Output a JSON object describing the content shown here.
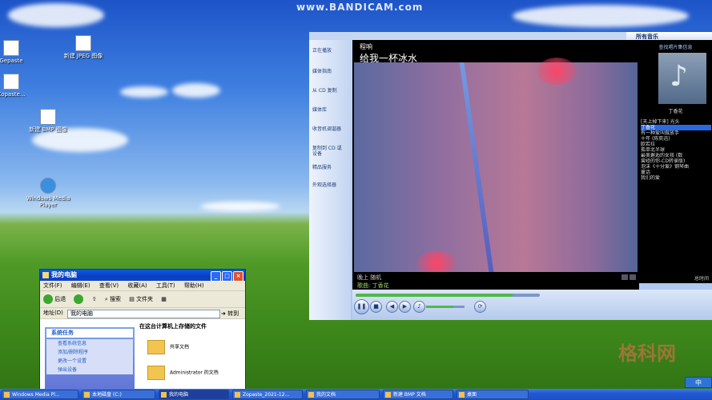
{
  "recorder": {
    "watermark": "www.BANDICAM.com"
  },
  "corner_logo": "格科网",
  "desktop_icons": [
    {
      "label": "Gepaste"
    },
    {
      "label": "新建 JPEG 图像"
    },
    {
      "label": "Zopaste..."
    },
    {
      "label": "新建 BMP 图像"
    },
    {
      "label": "Windows Media Player"
    }
  ],
  "explorer": {
    "title": "我的电脑",
    "menu": [
      "文件(F)",
      "编辑(E)",
      "查看(V)",
      "收藏(A)",
      "工具(T)",
      "帮助(H)"
    ],
    "toolbar": {
      "back": "后退",
      "search": "搜索",
      "folders": "文件夹"
    },
    "address_label": "地址(D)",
    "address_value": "我的电脑",
    "go_label": "转到",
    "task_header": "系统任务",
    "tasks": [
      "查看系统信息",
      "添加/删除程序",
      "更改一个设置",
      "弹出设备"
    ],
    "section_header": "在这台计算机上存储的文件",
    "folders": [
      "共享文档",
      "Administrator 的文档"
    ]
  },
  "wmp": {
    "nav": [
      "正在播放",
      "媒体指南",
      "从 CD 复制",
      "媒体库",
      "收音机调谐器",
      "复制到 CD 或设备",
      "精品服务",
      "外观选择器"
    ],
    "artist": "程响",
    "title": "给我一杯冰水",
    "status_line1": "晚上 随机",
    "status_line2": "歌曲: 丁香花",
    "seek_progress": 0.85,
    "volume_level": 0.7,
    "playlist_header": "所有音乐",
    "playlist_sub": "查找唱片集信息",
    "playlist_artist": "丁香花",
    "playlist_album": "[天上掉下来] 光头",
    "playlist_items": [
      {
        "text": "丁香花",
        "current": true
      },
      {
        "text": "有一种爱叫做放手"
      },
      {
        "text": "十年 (陈奕迅)"
      },
      {
        "text": "欧若拉"
      },
      {
        "text": "孤单北半球"
      },
      {
        "text": "最美邂逅的女孩 (数"
      },
      {
        "text": "曾经的你-CD转录版)"
      },
      {
        "text": "泡沫《十分爱》钢琴曲"
      },
      {
        "text": "童话"
      },
      {
        "text": "我们的爱"
      }
    ],
    "playlist_footer": "总时间"
  },
  "taskbar": {
    "tasks": [
      "Windows Media Pl...",
      "本地磁盘 (C:)",
      "我的电脑",
      "Zopaste_2021-12...",
      "我的文档",
      "新建 BMP 文档",
      "桌面"
    ],
    "tray": "中"
  }
}
